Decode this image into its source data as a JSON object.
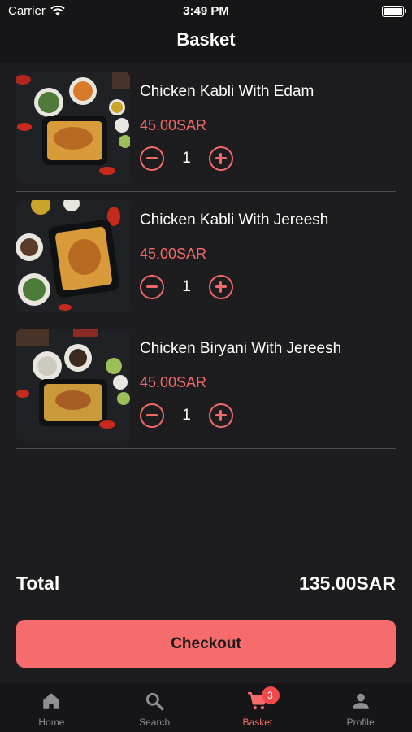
{
  "status_bar": {
    "carrier": "Carrier",
    "time": "3:49 PM"
  },
  "header": {
    "title": "Basket"
  },
  "basket": {
    "items": [
      {
        "name": "Chicken Kabli With Edam",
        "price": "45.00SAR",
        "quantity": "1"
      },
      {
        "name": "Chicken Kabli With Jereesh",
        "price": "45.00SAR",
        "quantity": "1"
      },
      {
        "name": "Chicken Biryani With Jereesh",
        "price": "45.00SAR",
        "quantity": "1"
      }
    ],
    "total_label": "Total",
    "total_value": "135.00SAR",
    "checkout_label": "Checkout"
  },
  "tabbar": {
    "tabs": [
      {
        "label": "Home",
        "icon": "home-icon"
      },
      {
        "label": "Search",
        "icon": "search-icon"
      },
      {
        "label": "Basket",
        "icon": "cart-icon",
        "badge": "3"
      },
      {
        "label": "Profile",
        "icon": "person-icon"
      }
    ]
  },
  "colors": {
    "accent": "#f66c6c",
    "background": "#1d1d1f",
    "bar": "#161618",
    "badge": "#f04a4a"
  }
}
